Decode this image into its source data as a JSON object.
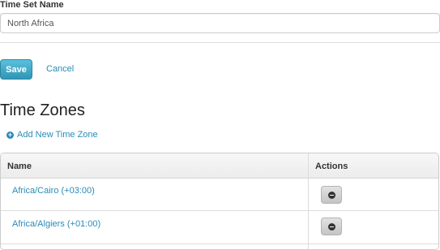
{
  "form": {
    "time_set_label": "Time Set Name",
    "time_set_value": "North Africa",
    "save_label": "Save",
    "cancel_label": "Cancel"
  },
  "time_zones": {
    "title": "Time Zones",
    "add_label": "Add New Time Zone",
    "add_icon": "plus-circle-icon",
    "columns": [
      "Name",
      "Actions"
    ],
    "rows": [
      {
        "name": "Africa/Cairo (+03:00)",
        "action_icon": "minus-circle-icon"
      },
      {
        "name": "Africa/Algiers (+01:00)",
        "action_icon": "minus-circle-icon"
      }
    ]
  },
  "colors": {
    "link": "#2a8bb5",
    "primary_button": "#49afcd",
    "remove_button": "#d5d5d5"
  }
}
